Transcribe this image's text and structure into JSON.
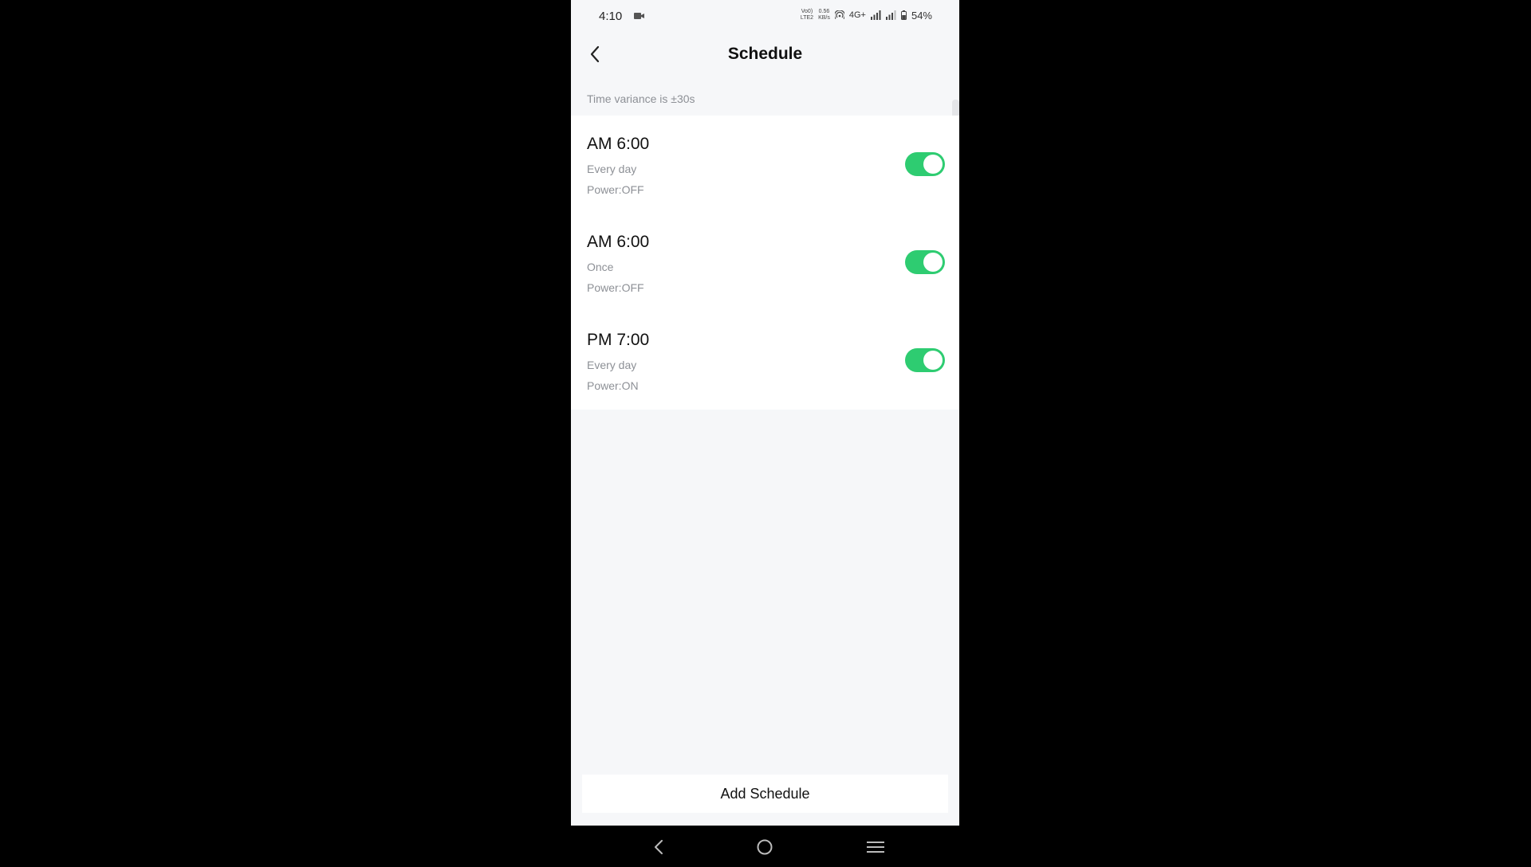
{
  "status_bar": {
    "time": "4:10",
    "volte_top": "Vo0)",
    "volte_bottom": "LTE2",
    "speed_value": "0.56",
    "speed_unit": "KB/s",
    "network": "4G+",
    "battery": "54%"
  },
  "header": {
    "title": "Schedule"
  },
  "hint": "Time variance is ±30s",
  "schedules": [
    {
      "time": "AM 6:00",
      "repeat": "Every day",
      "action": "Power:OFF",
      "enabled": true
    },
    {
      "time": "AM 6:00",
      "repeat": "Once",
      "action": "Power:OFF",
      "enabled": true
    },
    {
      "time": "PM 7:00",
      "repeat": "Every day",
      "action": "Power:ON",
      "enabled": true
    }
  ],
  "add_button_label": "Add Schedule",
  "colors": {
    "toggle_on": "#2ecc71",
    "background": "#f6f7f9",
    "secondary_text": "#8d9096"
  },
  "icons": {
    "back": "chevron-left-icon",
    "nav_back": "nav-back-icon",
    "nav_home": "nav-home-icon",
    "nav_menu": "nav-menu-icon"
  }
}
